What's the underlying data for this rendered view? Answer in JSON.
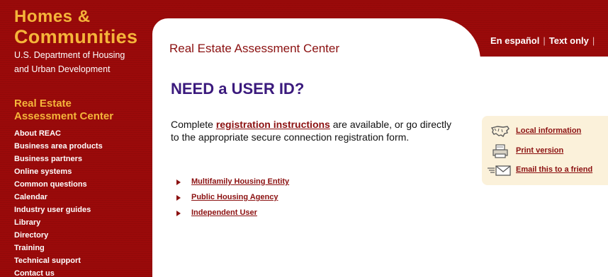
{
  "brand": {
    "line1": "Homes &",
    "line2": "Communities",
    "dept_line1": "U.S. Department of Housing",
    "dept_line2": "and Urban Development"
  },
  "sidebar": {
    "section_line1": "Real Estate",
    "section_line2": "Assessment Center",
    "items": [
      {
        "label": "About REAC"
      },
      {
        "label": "Business area products"
      },
      {
        "label": "Business partners"
      },
      {
        "label": "Online systems"
      },
      {
        "label": "Common questions"
      },
      {
        "label": "Calendar"
      },
      {
        "label": "Industry user guides"
      },
      {
        "label": "Library"
      },
      {
        "label": "Directory"
      },
      {
        "label": "Training"
      },
      {
        "label": "Technical support"
      },
      {
        "label": "Contact us"
      }
    ]
  },
  "header": {
    "title": "Real Estate Assessment Center",
    "spanish": "En español",
    "text_only": "Text only",
    "separator": "|"
  },
  "main": {
    "title": "NEED a USER ID?",
    "intro_before": "Complete ",
    "intro_link": "registration instructions",
    "intro_after": " are available, or go directly to the appropriate secure connection registration form.",
    "forms": [
      {
        "label": "Multifamily Housing Entity"
      },
      {
        "label": "Public Housing Agency"
      },
      {
        "label": "Independent User"
      }
    ]
  },
  "tools": {
    "local_info": "Local information",
    "print": "Print version",
    "email": "Email this to a friend"
  },
  "colors": {
    "hud_red": "#9b0a0a",
    "gold": "#f5b53a",
    "link_red": "#8b1010",
    "title_purple": "#3b1a7d",
    "tools_bg": "#fbf1da"
  }
}
